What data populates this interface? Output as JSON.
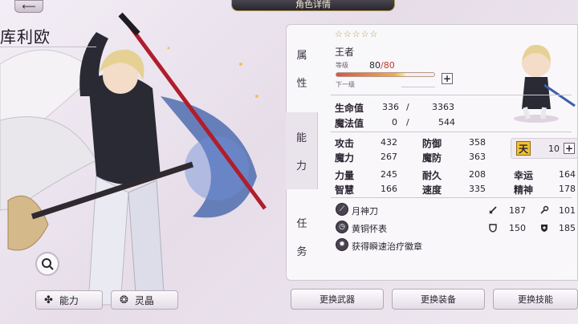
{
  "header": {
    "title": "角色详情"
  },
  "character": {
    "name": "库利欧",
    "stars": "☆☆☆☆☆",
    "title": "王者"
  },
  "level": {
    "label": "等级",
    "current": "80",
    "sep": "/",
    "max": "80",
    "next_label": "下一级",
    "exp_fraction": 0.7
  },
  "tabs": [
    {
      "char1": "属",
      "char2": "性"
    },
    {
      "char1": "能",
      "char2": "力"
    },
    {
      "char1": "任",
      "char2": "务"
    }
  ],
  "vitals": {
    "hp_label": "生命值",
    "hp_cur": "336",
    "hp_sep": "/",
    "hp_max": "3363",
    "mp_label": "魔法值",
    "mp_cur": "0",
    "mp_sep": "/",
    "mp_max": "544"
  },
  "stats": {
    "atk_label": "攻击",
    "atk": "432",
    "def_label": "防御",
    "def": "358",
    "matk_label": "魔力",
    "matk": "267",
    "mdef_label": "魔防",
    "mdef": "363",
    "str_label": "力量",
    "str": "245",
    "end_label": "耐久",
    "end": "208",
    "luck_label": "幸运",
    "luck": "164",
    "wis_label": "智慧",
    "wis": "166",
    "spd_label": "速度",
    "spd": "335",
    "spirit_label": "精神",
    "spirit": "178"
  },
  "rank": {
    "badge": "天",
    "value": "10"
  },
  "equipment": {
    "weapon": "月神刀",
    "accessory": "黄铜怀表",
    "medal": "获得瞬速治疗徽章",
    "weapon_atk": "187",
    "weapon_other": "101",
    "acc_def": "150",
    "acc_other": "185"
  },
  "buttons": {
    "ability": "能力",
    "crystal": "灵晶",
    "change_weapon": "更换武器",
    "change_equipment": "更换装备",
    "change_skill": "更换技能"
  },
  "colors": {
    "accent_red": "#c0392b",
    "gold": "#b89a4e"
  }
}
